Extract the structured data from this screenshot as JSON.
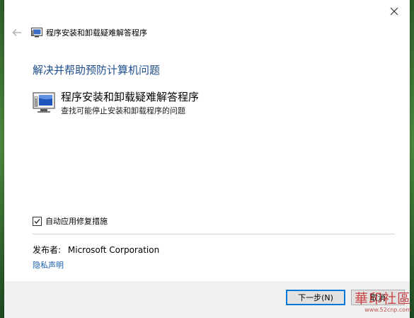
{
  "window": {
    "title": "程序安装和卸载疑难解答程序"
  },
  "heading": "解决并帮助预防计算机问题",
  "program": {
    "name": "程序安装和卸载疑难解答程序",
    "description": "查找可能停止安装和卸载程序的问题",
    "icon": "troubleshooter-monitor-icon"
  },
  "options": {
    "auto_fix_label": "自动应用修复措施",
    "auto_fix_checked": true
  },
  "publisher": {
    "label": "发布者:",
    "value": "Microsoft Corporation"
  },
  "privacy_link": "隐私声明",
  "buttons": {
    "next": "下一步(N)",
    "cancel": "取消"
  },
  "watermark": {
    "text": "華印社區",
    "url": "www.52cnp.com"
  },
  "colors": {
    "heading": "#1e4e8c",
    "link": "#1a5ea8",
    "focus": "#0078d7"
  }
}
